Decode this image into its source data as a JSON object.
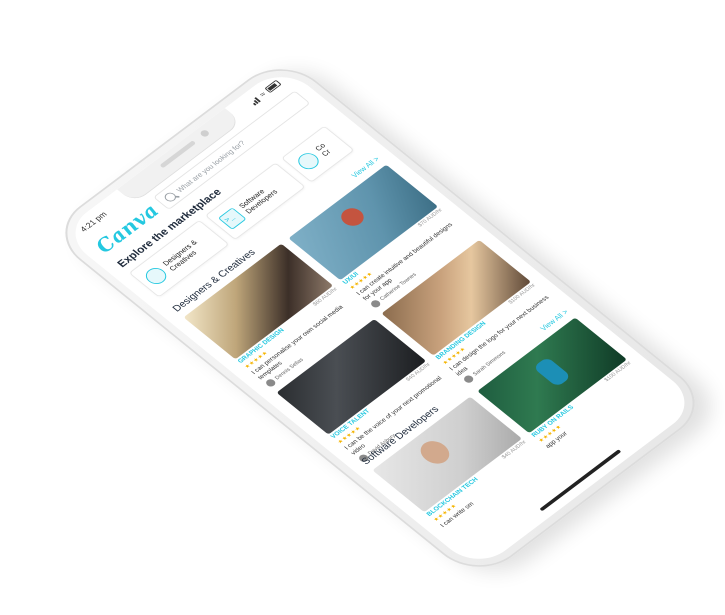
{
  "status_bar": {
    "time": "4:21 pm"
  },
  "header": {
    "logo": "Canva",
    "search_placeholder": "What are you looking for?"
  },
  "explore_title": "Explore the marketplace",
  "categories": [
    {
      "label": "Designers & Creatives",
      "icon": "palette-icon"
    },
    {
      "label": "Software Developers",
      "icon": "code-icon"
    },
    {
      "label": "Co Cr",
      "icon": "pencil-icon"
    }
  ],
  "sections": [
    {
      "title": "Designers & Creatives",
      "view_all": "View All >",
      "cards": [
        {
          "category": "GRAPHIC DESIGN",
          "price": "$60 AUD/hr",
          "stars": "★★★★★",
          "desc": "I can personalise your own social media templates",
          "seller": "Dennis Sellas"
        },
        {
          "category": "UX/UI",
          "price": "$70 AUD/hr",
          "stars": "★★★★★",
          "desc": "I can create intuitive and beautiful designs for your app",
          "seller": "Catherine Townes"
        },
        {
          "category": "VOICE TALENT",
          "price": "$40 AUD/hr",
          "stars": "★★★★★",
          "desc": "I can be the voice of your next promotional video",
          "seller": "David Asbury"
        },
        {
          "category": "BRANDING DESIGN",
          "price": "$100 AUD/hr",
          "stars": "★★★★★",
          "desc": "I can design the logo for your next business idea",
          "seller": "Sarah Simmons"
        }
      ]
    },
    {
      "title": "Software Developers",
      "view_all": "View All >",
      "cards": [
        {
          "category": "BLOCKCHAIN TECH",
          "price": "$40 AUD/hr",
          "stars": "★★★★★",
          "desc": "I can write sm",
          "seller": ""
        },
        {
          "category": "RUBY ON RAILS",
          "price": "$100 AUD/hr",
          "stars": "★★★★★",
          "desc": "app your",
          "seller": ""
        }
      ]
    }
  ],
  "colors": {
    "accent": "#24c8e0",
    "star": "#f4b400",
    "text_dark": "#1e2a3b"
  }
}
